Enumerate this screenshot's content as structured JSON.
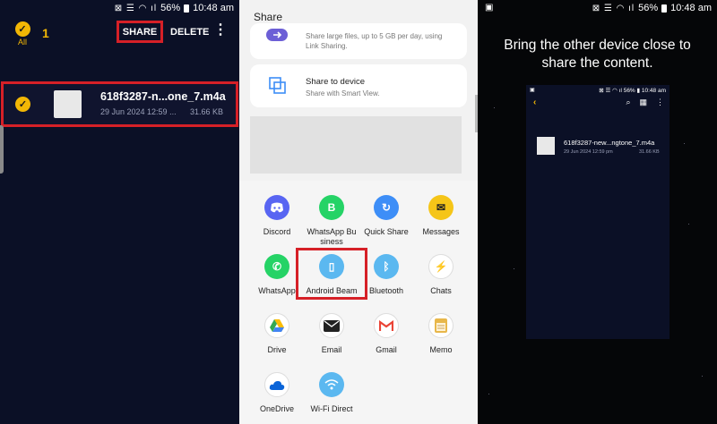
{
  "status_bar": {
    "signal_icons": "⊠ ☰ ◠ ıl",
    "battery": "56%",
    "time": "10:48 am"
  },
  "file_manager": {
    "selected_count": "1",
    "all_label": "All",
    "share_label": "SHARE",
    "delete_label": "DELETE",
    "more_label": "⋮",
    "file": {
      "name": "618f3287-n...one_7.m4a",
      "date": "29 Jun 2024 12:59 ...",
      "size": "31.66 KB"
    }
  },
  "share_sheet": {
    "title": "Share",
    "link_sharing": {
      "line1": "Share large files, up to 5 GB per day, using",
      "line2": "Link Sharing."
    },
    "share_to_device": {
      "title": "Share to device",
      "subtitle": "Share with Smart View."
    },
    "apps": [
      {
        "label": "Discord",
        "icon": "discord-icon",
        "color": "#5865F2"
      },
      {
        "label": "WhatsApp Bu\nsiness",
        "icon": "whatsapp-business-icon",
        "color": "#25D366"
      },
      {
        "label": "Quick Share",
        "icon": "quick-share-icon",
        "color": "#3d8ef7"
      },
      {
        "label": "Messages",
        "icon": "messages-icon",
        "color": "#f5c518"
      },
      {
        "label": "WhatsApp",
        "icon": "whatsapp-icon",
        "color": "#25D366"
      },
      {
        "label": "Android Beam",
        "icon": "android-beam-icon",
        "color": "#5bb8f0"
      },
      {
        "label": "Bluetooth",
        "icon": "bluetooth-icon",
        "color": "#5bb8f0"
      },
      {
        "label": "Chats",
        "icon": "messenger-icon",
        "color": "#2f6df6"
      },
      {
        "label": "Drive",
        "icon": "drive-icon",
        "color": "#ffffff"
      },
      {
        "label": "Email",
        "icon": "email-icon",
        "color": "#222222"
      },
      {
        "label": "Gmail",
        "icon": "gmail-icon",
        "color": "#ffffff"
      },
      {
        "label": "Memo",
        "icon": "memo-icon",
        "color": "#e8b74a"
      },
      {
        "label": "OneDrive",
        "icon": "onedrive-icon",
        "color": "#ffffff"
      },
      {
        "label": "Wi-Fi Direct",
        "icon": "wifi-direct-icon",
        "color": "#5bb8f0"
      }
    ]
  },
  "beam": {
    "message": "Bring the other device close to share the content.",
    "mini_status": "⊠ ☰ ◠ ıl 56% ▮ 10:48 am",
    "mini_file": {
      "name": "618f3287-new...ngtone_7.m4a",
      "date": "29 Jun 2024 12:59 pm",
      "size": "31.66 KB"
    }
  },
  "colors": {
    "accent": "#f2b705",
    "highlight": "#d62027",
    "dark_bg": "#0b1026"
  }
}
